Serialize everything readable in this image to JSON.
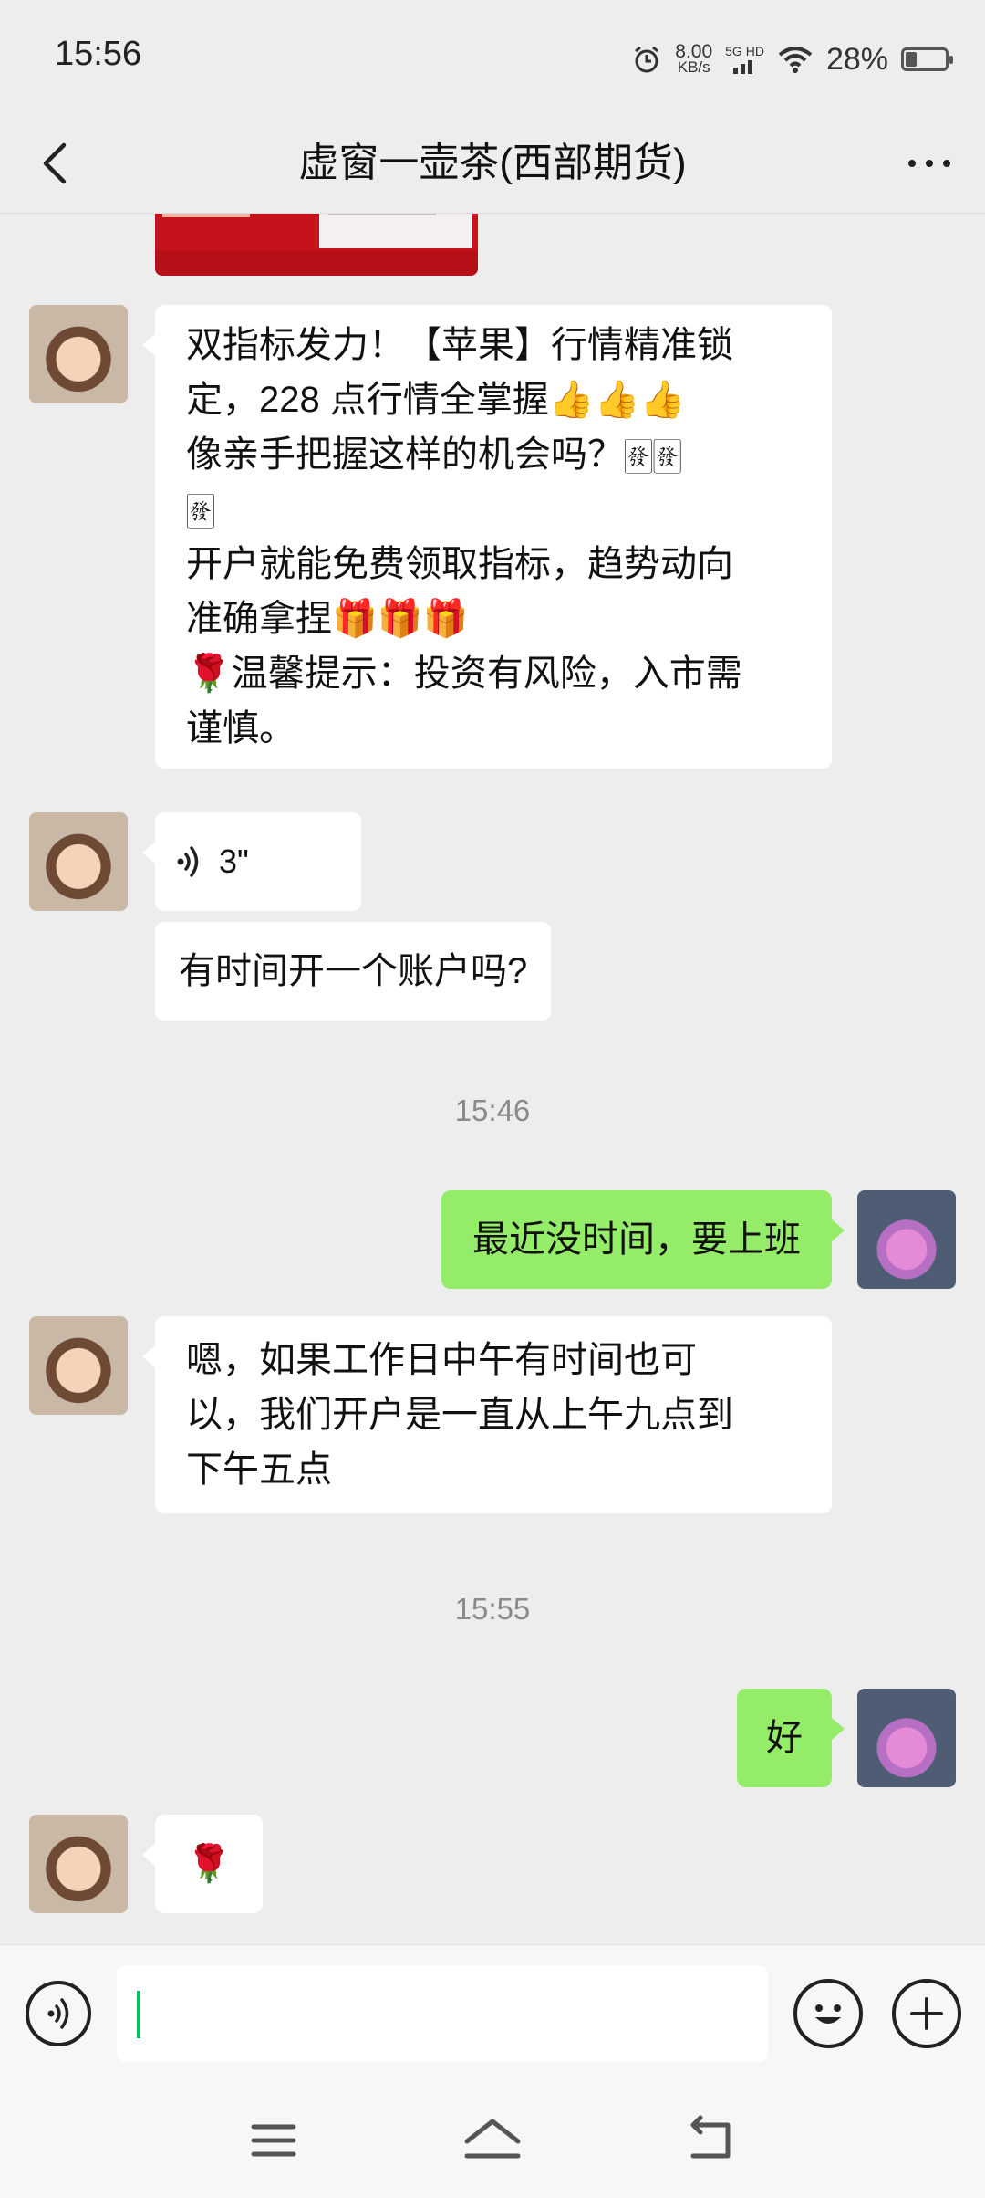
{
  "status_bar": {
    "time": "15:56",
    "net_speed_value": "8.00",
    "net_speed_unit": "KB/s",
    "network": "5G HD",
    "battery": "28%"
  },
  "header": {
    "title": "虚窗一壶茶(西部期货)"
  },
  "messages": {
    "m1": {
      "lines": [
        "双指标发力！【苹果】行情精准锁",
        "定，228 点行情全掌握👍👍👍",
        "像亲手把握这样的机会吗？🀅🀅",
        "🀅",
        "开户就能免费领取指标，趋势动向",
        "准确拿捏🎁🎁🎁",
        "🌹温馨提示：投资有风险，入市需",
        "谨慎。"
      ]
    },
    "m2": {
      "duration": "3\""
    },
    "m3": {
      "text": "有时间开一个账户吗?"
    },
    "ts1": "15:46",
    "m4": {
      "text": "最近没时间，要上班"
    },
    "m5": {
      "lines": [
        "嗯，如果工作日中午有时间也可",
        "以，我们开户是一直从上午九点到",
        "下午五点"
      ]
    },
    "ts2": "15:55",
    "m6": {
      "text": "好"
    },
    "m7": {
      "text": "🌹"
    }
  },
  "colors": {
    "background": "#ededed",
    "outgoing_bubble": "#95ec69",
    "incoming_bubble": "#ffffff",
    "caret": "#07c160"
  }
}
